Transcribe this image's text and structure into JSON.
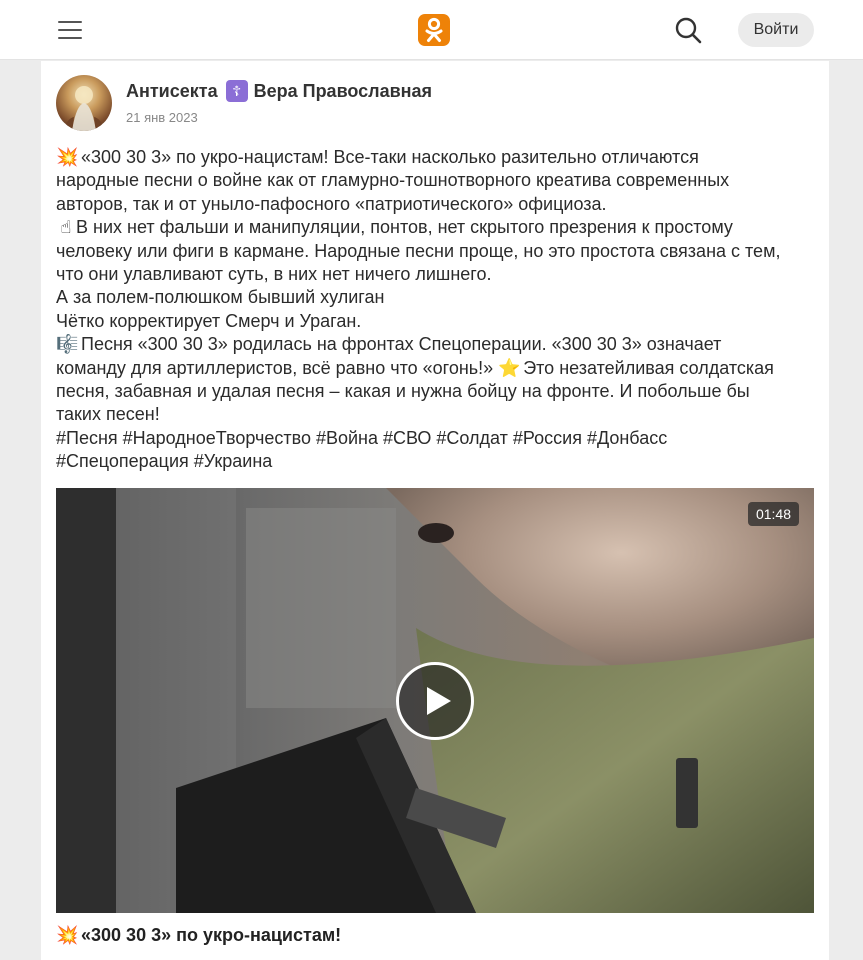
{
  "header": {
    "menu_icon": "hamburger-menu-icon",
    "logo_icon": "odnoklassniki-logo-icon",
    "search_icon": "search-icon",
    "login_label": "Войти",
    "brand_color": "#ee8208"
  },
  "post": {
    "author_part1": "Антисекта",
    "author_badge": "☦",
    "author_part2": "Вера Православная",
    "date": "21 янв 2023",
    "lines": [
      "«300 30 3» по укро-нацистам! Все-таки насколько разительно отличаются",
      "народные песни о войне как от гламурно-тошнотворного креатива современных",
      "авторов, так и от уныло-пафосного «патриотического» официоза.",
      "В них нет фальши и манипуляции, понтов, нет скрытого презрения к простому",
      "человеку или фиги в кармане. Народные песни проще, но это простота связана с тем,",
      "что они улавливают суть, в них нет ничего лишнего.",
      "А за полем-полюшком бывший хулиган",
      "Чётко корректирует Смерч и Ураган.",
      "Песня «300 30 3» родилась на фронтах Спецоперации. «300 30 3» означает",
      "команду для артиллеристов, всё равно что «огонь!»",
      "Это незатейливая солдатская",
      "песня, забавная и удалая песня – какая и нужна бойцу на фронте. И побольше бы",
      "таких песен!",
      "#Песня #НародноеТворчество #Война #СВО #Солдат #Россия #Донбасс",
      "#Спецоперация #Украина"
    ],
    "emoji": {
      "collision": "💥",
      "point_up": "☝",
      "music": "🎼",
      "star": "⭐"
    }
  },
  "video": {
    "duration": "01:48",
    "play_icon": "play-icon",
    "title": "«300 30 3» по укро-нацистам!"
  }
}
